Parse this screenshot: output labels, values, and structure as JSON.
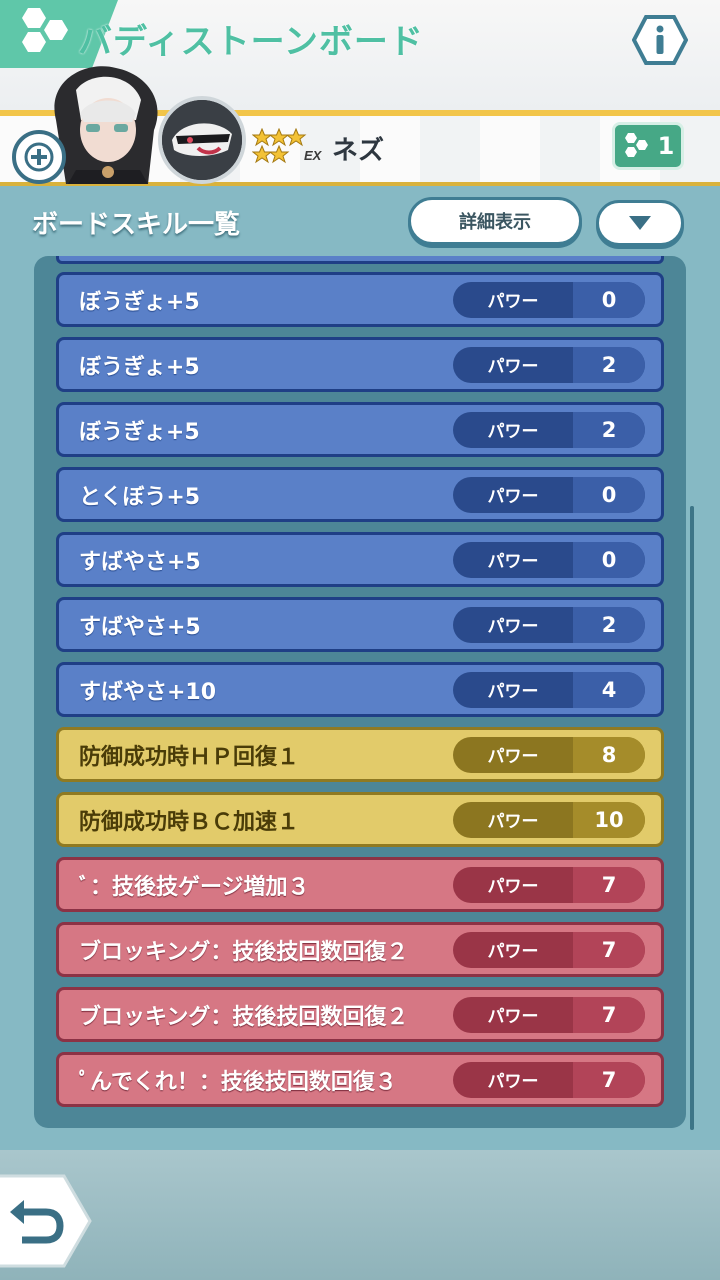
{
  "header": {
    "title": "バディストーンボード",
    "info_icon": "info-icon",
    "hex_icon": "hexagon-cluster-icon"
  },
  "character": {
    "name": "ネズ",
    "stars": 5,
    "rank_badge": "EX",
    "board_count": "1"
  },
  "section": {
    "title": "ボードスキル一覧",
    "detail_button": "詳細表示",
    "sort_icon": "triangle-down-icon"
  },
  "skills": [
    {
      "name": "ぼうぎょ+5",
      "power_label": "パワー",
      "power": "0",
      "color": "blue"
    },
    {
      "name": "ぼうぎょ+5",
      "power_label": "パワー",
      "power": "2",
      "color": "blue"
    },
    {
      "name": "ぼうぎょ+5",
      "power_label": "パワー",
      "power": "2",
      "color": "blue"
    },
    {
      "name": "とくぼう+5",
      "power_label": "パワー",
      "power": "0",
      "color": "blue"
    },
    {
      "name": "すばやさ+5",
      "power_label": "パワー",
      "power": "0",
      "color": "blue"
    },
    {
      "name": "すばやさ+5",
      "power_label": "パワー",
      "power": "2",
      "color": "blue"
    },
    {
      "name": "すばやさ+10",
      "power_label": "パワー",
      "power": "4",
      "color": "blue"
    },
    {
      "name": "防御成功時ＨＰ回復１",
      "power_label": "パワー",
      "power": "8",
      "color": "yellow"
    },
    {
      "name": "防御成功時ＢＣ加速１",
      "power_label": "パワー",
      "power": "10",
      "color": "yellow"
    },
    {
      "name": "ﾞ：技後技ゲージ増加３",
      "power_label": "パワー",
      "power": "7",
      "color": "red"
    },
    {
      "name": "ブロッキング：技後技回数回復２",
      "power_label": "パワー",
      "power": "7",
      "color": "red"
    },
    {
      "name": "ブロッキング：技後技回数回復２",
      "power_label": "パワー",
      "power": "7",
      "color": "red"
    },
    {
      "name": "ﾟんでくれ！：技後技回数回復３",
      "power_label": "パワー",
      "power": "7",
      "color": "red"
    }
  ],
  "footer": {
    "back_icon": "return-arrow-icon"
  },
  "colors": {
    "accent": "#4fc0a3",
    "blue_row": "#5a80c8",
    "yellow_row": "#e2cb6a",
    "red_row": "#d67784",
    "background": "#86b9c4"
  }
}
